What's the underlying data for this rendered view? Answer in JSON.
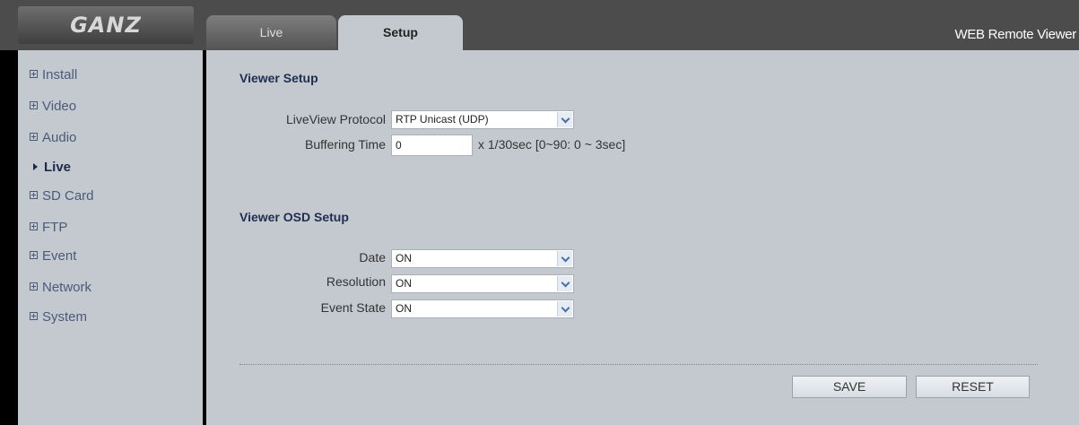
{
  "header": {
    "logo": "GANZ",
    "app_title": "WEB Remote Viewer",
    "tabs": [
      {
        "label": "Live",
        "active": false
      },
      {
        "label": "Setup",
        "active": true
      }
    ]
  },
  "sidebar": {
    "items": [
      {
        "label": "Install"
      },
      {
        "label": "Video"
      },
      {
        "label": "Audio"
      },
      {
        "label": "Live",
        "active": true
      },
      {
        "label": "SD Card"
      },
      {
        "label": "FTP"
      },
      {
        "label": "Event"
      },
      {
        "label": "Network"
      },
      {
        "label": "System"
      }
    ]
  },
  "viewer_setup": {
    "title": "Viewer Setup",
    "protocol_label": "LiveView Protocol",
    "protocol_value": "RTP Unicast (UDP)",
    "buffering_label": "Buffering Time",
    "buffering_value": "0",
    "buffering_hint": "x 1/30sec [0~90: 0 ~ 3sec]"
  },
  "osd_setup": {
    "title": "Viewer OSD Setup",
    "date_label": "Date",
    "date_value": "ON",
    "resolution_label": "Resolution",
    "resolution_value": "ON",
    "event_state_label": "Event State",
    "event_state_value": "ON"
  },
  "actions": {
    "save_label": "SAVE",
    "reset_label": "RESET"
  },
  "colors": {
    "panel_bg": "#c4c9cf",
    "frame_bg": "#4c4c4c",
    "nav_text": "#4a5a78",
    "heading": "#1e2d50"
  }
}
